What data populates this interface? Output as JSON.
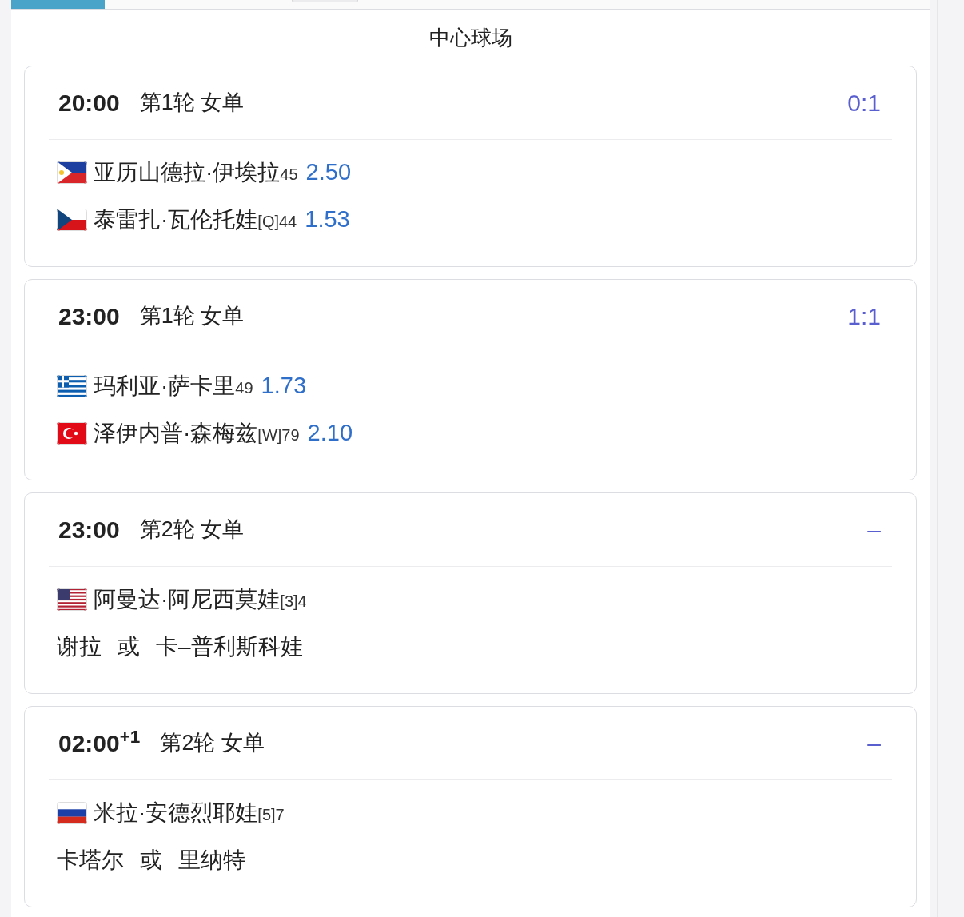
{
  "court_title": "中心球场",
  "matches": [
    {
      "time": "20:00",
      "round": "第1轮 女单",
      "score": "0:1",
      "entries": [
        {
          "kind": "player",
          "flag": {
            "kind": "ph"
          },
          "name": "亚历山德拉·伊埃拉",
          "rank": "45",
          "odds": "2.50"
        },
        {
          "kind": "player",
          "flag": {
            "kind": "cz"
          },
          "name": "泰雷扎·瓦伦托娃",
          "rank": "[Q]44",
          "odds": "1.53"
        }
      ]
    },
    {
      "time": "23:00",
      "round": "第1轮 女单",
      "score": "1:1",
      "entries": [
        {
          "kind": "player",
          "flag": {
            "kind": "gr"
          },
          "name": "玛利亚·萨卡里",
          "rank": "49",
          "odds": "1.73"
        },
        {
          "kind": "player",
          "flag": {
            "kind": "tr"
          },
          "name": "泽伊内普·森梅兹",
          "rank": "[W]79",
          "odds": "2.10"
        }
      ]
    },
    {
      "time": "23:00",
      "round": "第2轮 女单",
      "score": "–",
      "entries": [
        {
          "kind": "player",
          "flag": {
            "kind": "us"
          },
          "name": "阿曼达·阿尼西莫娃",
          "rank": "[3]4"
        },
        {
          "kind": "either",
          "options": [
            "谢拉",
            "卡–普利斯科娃"
          ],
          "separator": "或"
        }
      ]
    },
    {
      "time": "02:00$^{+1}$",
      "round": "第2轮 女单",
      "score": "–",
      "entries": [
        {
          "kind": "player",
          "flag": {
            "kind": "ru"
          },
          "name": "米拉·安德烈耶娃",
          "rank": "[5]7"
        },
        {
          "kind": "either",
          "options": [
            "卡塔尔",
            "里纳特"
          ],
          "separator": "或"
        }
      ]
    }
  ]
}
